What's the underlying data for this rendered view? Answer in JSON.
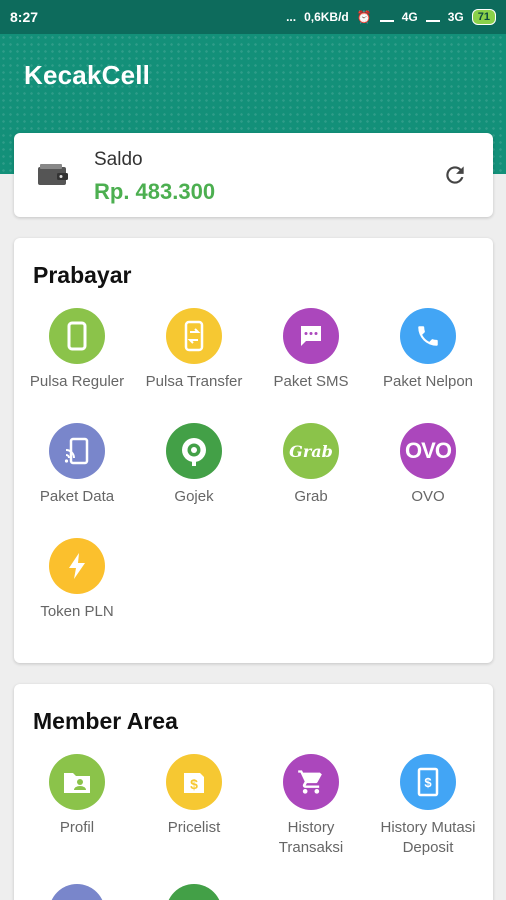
{
  "status_bar": {
    "time": "8:27",
    "dots": "...",
    "net_speed": "0,6KB/d",
    "net1": "4G",
    "net2": "3G",
    "battery": "71"
  },
  "app": {
    "title": "KecakCell"
  },
  "saldo": {
    "label": "Saldo",
    "value": "Rp. 483.300"
  },
  "prabayar": {
    "title": "Prabayar",
    "items": [
      {
        "label": "Pulsa Reguler",
        "icon": "phone-device-icon",
        "color": "#8bc34a"
      },
      {
        "label": "Pulsa Transfer",
        "icon": "phone-transfer-icon",
        "color": "#f6c832"
      },
      {
        "label": "Paket SMS",
        "icon": "sms-icon",
        "color": "#ab47bc"
      },
      {
        "label": "Paket Nelpon",
        "icon": "phone-call-icon",
        "color": "#42a5f5"
      },
      {
        "label": "Paket Data",
        "icon": "cast-data-icon",
        "color": "#7986cb"
      },
      {
        "label": "Gojek",
        "icon": "gojek-icon",
        "color": "#43a047"
      },
      {
        "label": "Grab",
        "icon": "grab-icon",
        "logo_text": "Grab",
        "color": "#8bc34a"
      },
      {
        "label": "OVO",
        "icon": "ovo-icon",
        "logo_text": "OVO",
        "color": "#ab47bc"
      },
      {
        "label": "Token PLN",
        "icon": "lightning-icon",
        "color": "#fbc02d"
      }
    ]
  },
  "member_area": {
    "title": "Member Area",
    "items": [
      {
        "label": "Profil",
        "icon": "profile-folder-icon",
        "color": "#8bc34a"
      },
      {
        "label": "Pricelist",
        "icon": "price-tag-icon",
        "color": "#f6c832"
      },
      {
        "label": "History\nTransaksi",
        "icon": "cart-icon",
        "color": "#ab47bc"
      },
      {
        "label": "History Mutasi\nDeposit",
        "icon": "deposit-icon",
        "color": "#42a5f5"
      }
    ]
  }
}
